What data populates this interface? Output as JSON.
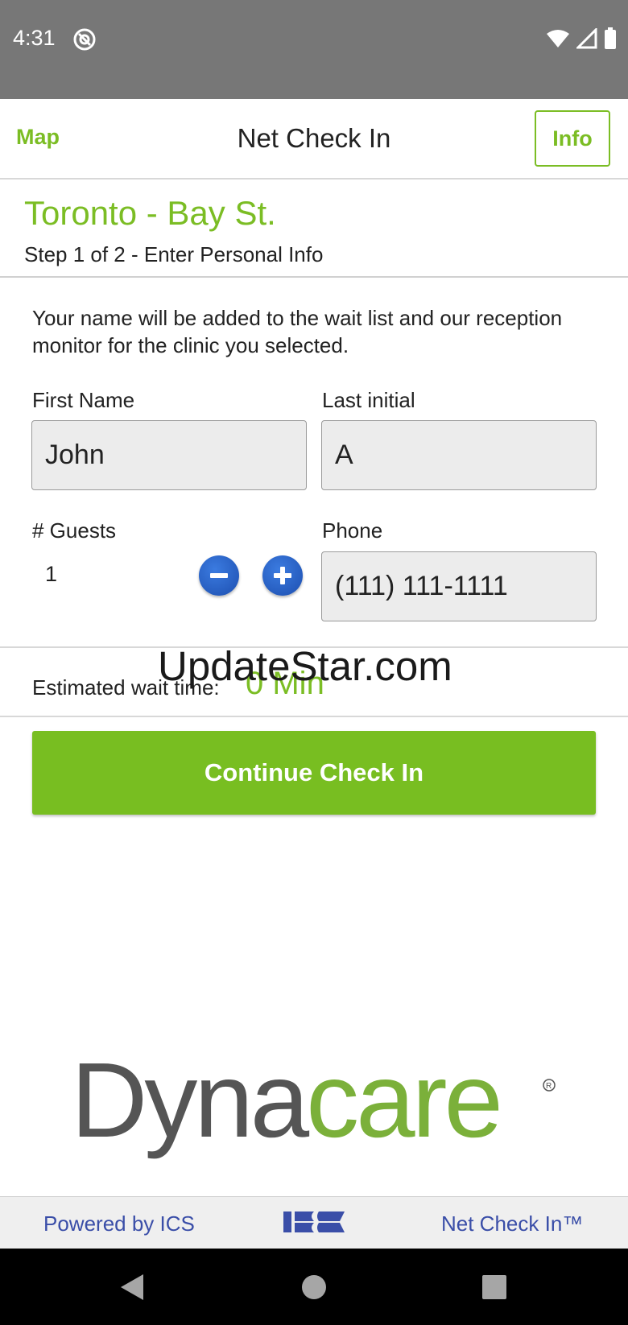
{
  "status_bar": {
    "time": "4:31"
  },
  "header": {
    "map_label": "Map",
    "title": "Net Check In",
    "info_label": "Info"
  },
  "location": {
    "name": "Toronto - Bay St.",
    "step": "Step 1 of 2 - Enter Personal Info"
  },
  "form": {
    "intro": "Your name will be added to the wait list and our reception monitor for the clinic you selected.",
    "first_name_label": "First Name",
    "first_name_value": "John",
    "last_initial_label": "Last initial",
    "last_initial_value": "A",
    "guests_label": "# Guests",
    "guests_value": "1",
    "phone_label": "Phone",
    "phone_value": "(111) 111-1111"
  },
  "wait": {
    "label": "Estimated wait time:",
    "value": "0 Min"
  },
  "watermark": "UpdateStar.com",
  "continue_label": "Continue Check In",
  "logo_text": "Dynacare",
  "footer": {
    "left": "Powered by ICS",
    "right": "Net Check In™"
  },
  "colors": {
    "accent": "#7bbd24",
    "footer_text": "#3a4ea8",
    "stepper": "#1d4fb0"
  }
}
